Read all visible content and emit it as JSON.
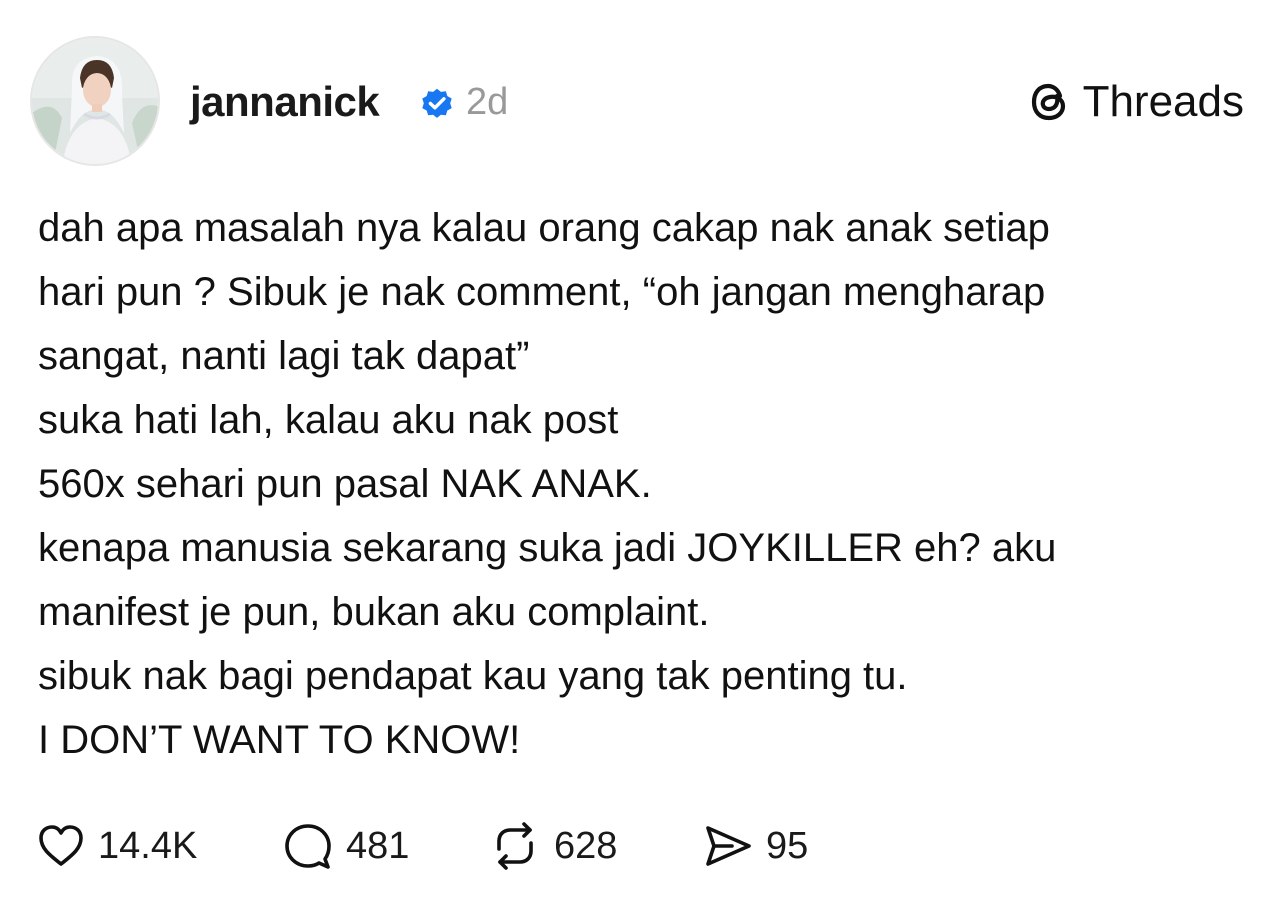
{
  "post": {
    "username": "jannanick",
    "time": "2d",
    "brand": "Threads",
    "lines": [
      "dah apa masalah nya kalau orang cakap nak anak setiap",
      "hari pun ? Sibuk je nak comment, “oh jangan mengharap",
      "sangat, nanti lagi tak dapat”",
      "suka hati lah, kalau aku nak post",
      "560x sehari pun pasal NAK ANAK.",
      "kenapa manusia sekarang suka jadi JOYKILLER eh? aku",
      "manifest je pun, bukan aku complaint.",
      "sibuk nak bagi pendapat kau yang tak penting tu.",
      "I DON’T WANT TO KNOW!"
    ]
  },
  "actions": {
    "likes": "14.4K",
    "comments": "481",
    "reposts": "628",
    "shares": "95"
  },
  "icons": {
    "verified": "verified-badge-icon",
    "brand": "threads-logo-icon",
    "like": "heart-icon",
    "comment": "comment-bubble-icon",
    "repost": "repost-icon",
    "share": "send-icon"
  },
  "colors": {
    "verified": "#1877f2",
    "text": "#111111",
    "muted": "#999999"
  }
}
